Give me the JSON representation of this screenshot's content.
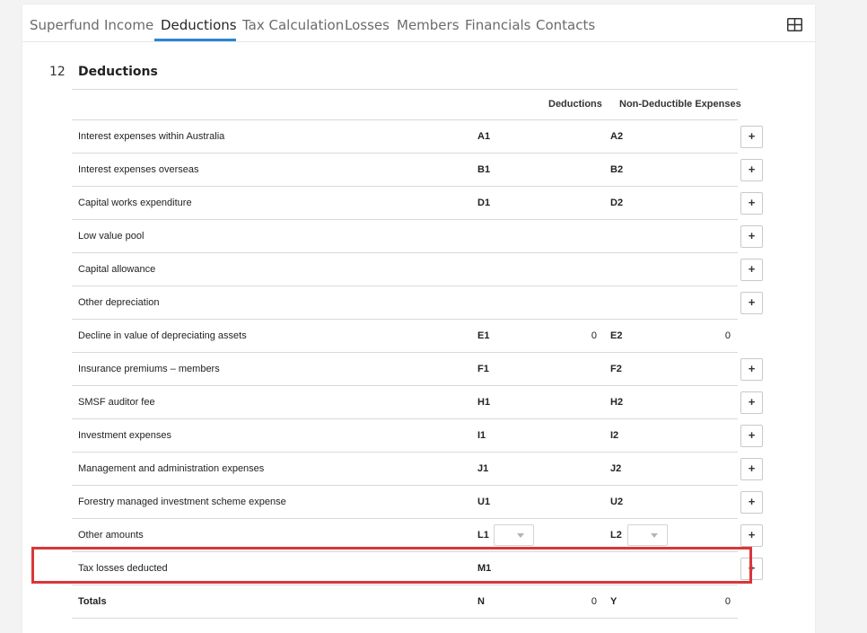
{
  "tabs": [
    "Superfund",
    "Income",
    "Deductions",
    "Tax Calculation",
    "Losses",
    "Members",
    "Financials",
    "Contacts"
  ],
  "active_tab": "Deductions",
  "section": {
    "number": "12",
    "title": "Deductions"
  },
  "columns": {
    "deductions": "Deductions",
    "non_deductible": "Non-Deductible Expenses"
  },
  "plus_label": "+",
  "rows": [
    {
      "label": "Interest expenses within Australia",
      "code1": "A1",
      "code2": "A2",
      "val1": "",
      "val2": ""
    },
    {
      "label": "Interest expenses overseas",
      "code1": "B1",
      "code2": "B2",
      "val1": "",
      "val2": ""
    },
    {
      "label": "Capital works expenditure",
      "code1": "D1",
      "code2": "D2",
      "val1": "",
      "val2": ""
    },
    {
      "label": "Low value pool",
      "code1": "",
      "code2": "",
      "val1": "",
      "val2": ""
    },
    {
      "label": "Capital allowance",
      "code1": "",
      "code2": "",
      "val1": "",
      "val2": ""
    },
    {
      "label": "Other depreciation",
      "code1": "",
      "code2": "",
      "val1": "",
      "val2": ""
    },
    {
      "label": "Decline in value of depreciating assets",
      "code1": "E1",
      "code2": "E2",
      "val1": "0",
      "val2": "0"
    },
    {
      "label": "Insurance premiums – members",
      "code1": "F1",
      "code2": "F2",
      "val1": "",
      "val2": ""
    },
    {
      "label": "SMSF auditor fee",
      "code1": "H1",
      "code2": "H2",
      "val1": "",
      "val2": ""
    },
    {
      "label": "Investment expenses",
      "code1": "I1",
      "code2": "I2",
      "val1": "",
      "val2": ""
    },
    {
      "label": "Management and administration expenses",
      "code1": "J1",
      "code2": "J2",
      "val1": "",
      "val2": ""
    },
    {
      "label": "Forestry managed investment scheme expense",
      "code1": "U1",
      "code2": "U2",
      "val1": "",
      "val2": ""
    },
    {
      "label": "Other amounts",
      "code1": "L1",
      "code2": "L2",
      "val1": "",
      "val2": ""
    },
    {
      "label": "Tax losses deducted",
      "code1": "M1",
      "code2": "",
      "val1": "",
      "val2": ""
    },
    {
      "label": "Totals",
      "code1": "N",
      "code2": "Y",
      "val1": "0",
      "val2": "0"
    }
  ],
  "icons": {
    "layout": "grid-layout-icon",
    "dropdown": "chevron-down-icon"
  },
  "colors": {
    "accent": "#2a86d1",
    "highlight": "#d9363a"
  }
}
